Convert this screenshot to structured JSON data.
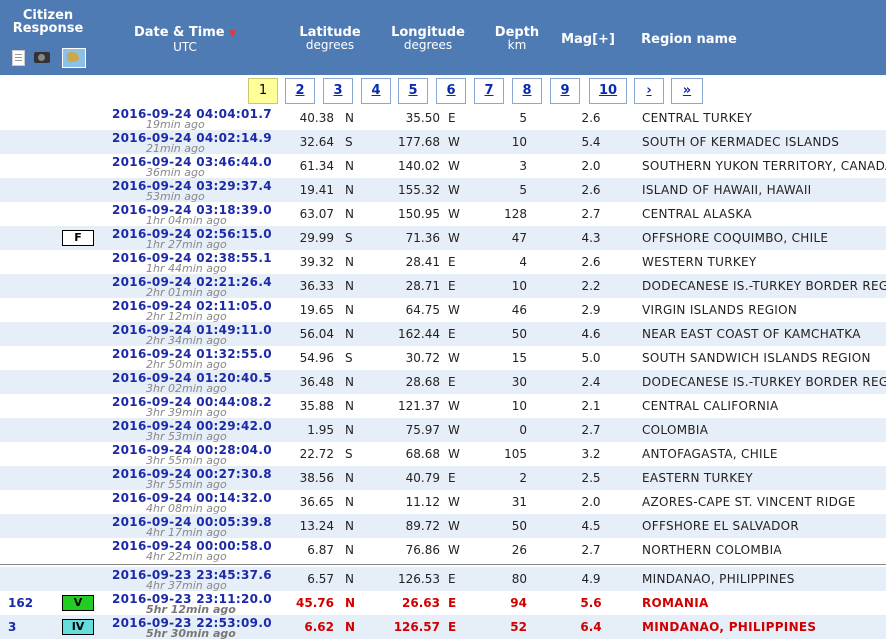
{
  "header": {
    "citizen_response": "Citizen Response",
    "date_time": "Date & Time",
    "date_sort_arrow": "▼",
    "utc": "UTC",
    "latitude": "Latitude",
    "latitude_unit": "degrees",
    "longitude": "Longitude",
    "longitude_unit": "degrees",
    "depth": "Depth",
    "depth_unit": "km",
    "mag": "Mag[+]",
    "region": "Region name",
    "icons": [
      "document-icon",
      "camera-icon",
      "map-icon"
    ]
  },
  "pager": {
    "pages": [
      "1",
      "2",
      "3",
      "4",
      "5",
      "6",
      "7",
      "8",
      "9",
      "10",
      "›",
      "»"
    ],
    "active": "1"
  },
  "colors": {
    "header_bg": "#4e7bb4",
    "alt_row": "#e6eef8",
    "highlight": "#d00000",
    "badge_V": "#22cc22",
    "badge_IV": "#66dddd"
  },
  "rows": [
    {
      "resp": "",
      "badge": "",
      "dt": "2016-09-24   04:04:01.7",
      "ago": "19min ago",
      "lat": "40.38",
      "latd": "N",
      "lon": "35.50",
      "lond": "E",
      "dep": "5",
      "mag": "2.6",
      "reg": "CENTRAL TURKEY"
    },
    {
      "resp": "",
      "badge": "",
      "dt": "2016-09-24   04:02:14.9",
      "ago": "21min ago",
      "lat": "32.64",
      "latd": "S",
      "lon": "177.68",
      "lond": "W",
      "dep": "10",
      "mag": "5.4",
      "reg": "SOUTH OF KERMADEC ISLANDS"
    },
    {
      "resp": "",
      "badge": "",
      "dt": "2016-09-24   03:46:44.0",
      "ago": "36min ago",
      "lat": "61.34",
      "latd": "N",
      "lon": "140.02",
      "lond": "W",
      "dep": "3",
      "mag": "2.0",
      "reg": "SOUTHERN YUKON TERRITORY, CANADA"
    },
    {
      "resp": "",
      "badge": "",
      "dt": "2016-09-24   03:29:37.4",
      "ago": "53min ago",
      "lat": "19.41",
      "latd": "N",
      "lon": "155.32",
      "lond": "W",
      "dep": "5",
      "mag": "2.6",
      "reg": "ISLAND OF HAWAII, HAWAII"
    },
    {
      "resp": "",
      "badge": "",
      "dt": "2016-09-24   03:18:39.0",
      "ago": "1hr 04min ago",
      "lat": "63.07",
      "latd": "N",
      "lon": "150.95",
      "lond": "W",
      "dep": "128",
      "mag": "2.7",
      "reg": "CENTRAL ALASKA"
    },
    {
      "resp": "",
      "badge": "F",
      "dt": "2016-09-24   02:56:15.0",
      "ago": "1hr 27min ago",
      "lat": "29.99",
      "latd": "S",
      "lon": "71.36",
      "lond": "W",
      "dep": "47",
      "mag": "4.3",
      "reg": "OFFSHORE COQUIMBO, CHILE"
    },
    {
      "resp": "",
      "badge": "",
      "dt": "2016-09-24   02:38:55.1",
      "ago": "1hr 44min ago",
      "lat": "39.32",
      "latd": "N",
      "lon": "28.41",
      "lond": "E",
      "dep": "4",
      "mag": "2.6",
      "reg": "WESTERN TURKEY"
    },
    {
      "resp": "",
      "badge": "",
      "dt": "2016-09-24   02:21:26.4",
      "ago": "2hr 01min ago",
      "lat": "36.33",
      "latd": "N",
      "lon": "28.71",
      "lond": "E",
      "dep": "10",
      "mag": "2.2",
      "reg": "DODECANESE IS.-TURKEY BORDER REG"
    },
    {
      "resp": "",
      "badge": "",
      "dt": "2016-09-24   02:11:05.0",
      "ago": "2hr 12min ago",
      "lat": "19.65",
      "latd": "N",
      "lon": "64.75",
      "lond": "W",
      "dep": "46",
      "mag": "2.9",
      "reg": "VIRGIN ISLANDS REGION"
    },
    {
      "resp": "",
      "badge": "",
      "dt": "2016-09-24   01:49:11.0",
      "ago": "2hr 34min ago",
      "lat": "56.04",
      "latd": "N",
      "lon": "162.44",
      "lond": "E",
      "dep": "50",
      "mag": "4.6",
      "reg": "NEAR EAST COAST OF KAMCHATKA"
    },
    {
      "resp": "",
      "badge": "",
      "dt": "2016-09-24   01:32:55.0",
      "ago": "2hr 50min ago",
      "lat": "54.96",
      "latd": "S",
      "lon": "30.72",
      "lond": "W",
      "dep": "15",
      "mag": "5.0",
      "reg": "SOUTH SANDWICH ISLANDS REGION"
    },
    {
      "resp": "",
      "badge": "",
      "dt": "2016-09-24   01:20:40.5",
      "ago": "3hr 02min ago",
      "lat": "36.48",
      "latd": "N",
      "lon": "28.68",
      "lond": "E",
      "dep": "30",
      "mag": "2.4",
      "reg": "DODECANESE IS.-TURKEY BORDER REG"
    },
    {
      "resp": "",
      "badge": "",
      "dt": "2016-09-24   00:44:08.2",
      "ago": "3hr 39min ago",
      "lat": "35.88",
      "latd": "N",
      "lon": "121.37",
      "lond": "W",
      "dep": "10",
      "mag": "2.1",
      "reg": "CENTRAL CALIFORNIA"
    },
    {
      "resp": "",
      "badge": "",
      "dt": "2016-09-24   00:29:42.0",
      "ago": "3hr 53min ago",
      "lat": "1.95",
      "latd": "N",
      "lon": "75.97",
      "lond": "W",
      "dep": "0",
      "mag": "2.7",
      "reg": "COLOMBIA"
    },
    {
      "resp": "",
      "badge": "",
      "dt": "2016-09-24   00:28:04.0",
      "ago": "3hr 55min ago",
      "lat": "22.72",
      "latd": "S",
      "lon": "68.68",
      "lond": "W",
      "dep": "105",
      "mag": "3.2",
      "reg": "ANTOFAGASTA, CHILE"
    },
    {
      "resp": "",
      "badge": "",
      "dt": "2016-09-24   00:27:30.8",
      "ago": "3hr 55min ago",
      "lat": "38.56",
      "latd": "N",
      "lon": "40.79",
      "lond": "E",
      "dep": "2",
      "mag": "2.5",
      "reg": "EASTERN TURKEY"
    },
    {
      "resp": "",
      "badge": "",
      "dt": "2016-09-24   00:14:32.0",
      "ago": "4hr 08min ago",
      "lat": "36.65",
      "latd": "N",
      "lon": "11.12",
      "lond": "W",
      "dep": "31",
      "mag": "2.0",
      "reg": "AZORES-CAPE ST. VINCENT RIDGE"
    },
    {
      "resp": "",
      "badge": "",
      "dt": "2016-09-24   00:05:39.8",
      "ago": "4hr 17min ago",
      "lat": "13.24",
      "latd": "N",
      "lon": "89.72",
      "lond": "W",
      "dep": "50",
      "mag": "4.5",
      "reg": "OFFSHORE EL SALVADOR"
    },
    {
      "resp": "",
      "badge": "",
      "dt": "2016-09-24   00:00:58.0",
      "ago": "4hr 22min ago",
      "lat": "6.87",
      "latd": "N",
      "lon": "76.86",
      "lond": "W",
      "dep": "26",
      "mag": "2.7",
      "reg": "NORTHERN COLOMBIA"
    },
    {
      "resp": "",
      "badge": "",
      "dt": "2016-09-23   23:45:37.6",
      "ago": "4hr 37min ago",
      "lat": "6.57",
      "latd": "N",
      "lon": "126.53",
      "lond": "E",
      "dep": "80",
      "mag": "4.9",
      "reg": "MINDANAO, PHILIPPINES"
    },
    {
      "resp": "162",
      "badge": "V",
      "dt": "2016-09-23   23:11:20.0",
      "ago": "5hr 12min ago",
      "lat": "45.76",
      "latd": "N",
      "lon": "26.63",
      "lond": "E",
      "dep": "94",
      "mag": "5.6",
      "reg": "ROMANIA",
      "red": true
    },
    {
      "resp": "3",
      "badge": "IV",
      "dt": "2016-09-23   22:53:09.0",
      "ago": "5hr 30min ago",
      "lat": "6.62",
      "latd": "N",
      "lon": "126.57",
      "lond": "E",
      "dep": "52",
      "mag": "6.4",
      "reg": "MINDANAO, PHILIPPINES",
      "red": true
    }
  ]
}
